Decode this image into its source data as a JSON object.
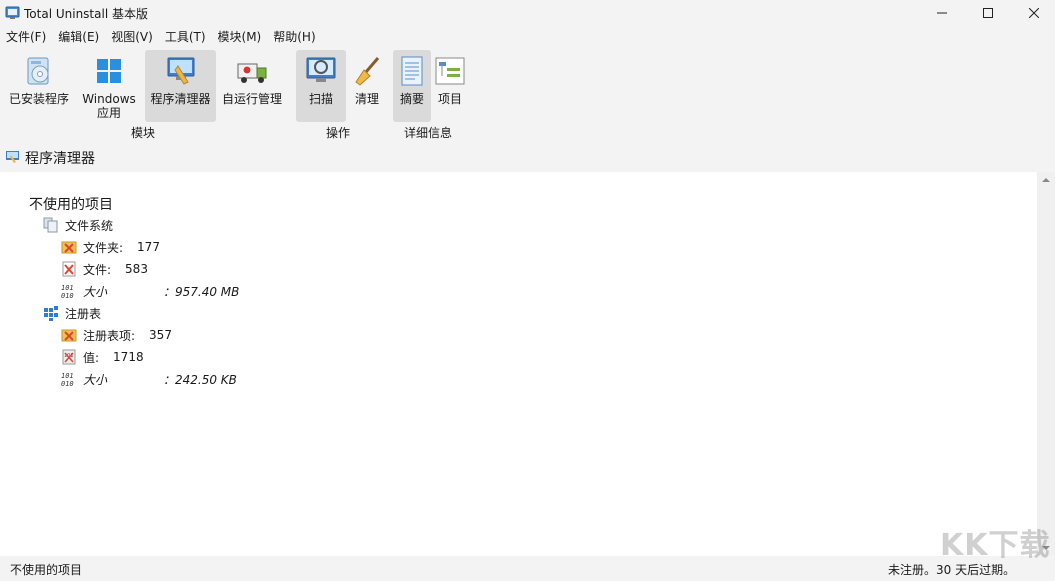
{
  "window": {
    "title": "Total Uninstall 基本版"
  },
  "menu": [
    "文件(F)",
    "编辑(E)",
    "视图(V)",
    "工具(T)",
    "模块(M)",
    "帮助(H)"
  ],
  "ribbon": {
    "modules": {
      "label": "模块",
      "installed": "已安装程序",
      "windows_apps_1": "Windows",
      "windows_apps_2": "应用",
      "cleaner": "程序清理器",
      "autorun": "自运行管理"
    },
    "actions": {
      "label": "操作",
      "scan": "扫描",
      "clean": "清理"
    },
    "details": {
      "label": "详细信息",
      "summary": "摘要",
      "items": "项目"
    }
  },
  "pane": {
    "title": "程序清理器"
  },
  "tree": {
    "root": "不使用的项目",
    "filesystem": {
      "label": "文件系统",
      "folders_label": "文件夹:",
      "folders_value": "177",
      "files_label": "文件:",
      "files_value": "583",
      "size_label": "大小",
      "size_value": "：957.40 MB"
    },
    "registry": {
      "label": "注册表",
      "keys_label": "注册表项:",
      "keys_value": "357",
      "values_label": "值:",
      "values_value": "1718",
      "size_label": "大小",
      "size_value": "：242.50 KB"
    }
  },
  "status": {
    "left": "不使用的项目",
    "right": "未注册。30 天后过期。"
  },
  "watermark": "KK下载",
  "colors": {
    "accent": "#1e6fd9",
    "active_button": "#dadada",
    "content_bg": "#ffffff"
  }
}
